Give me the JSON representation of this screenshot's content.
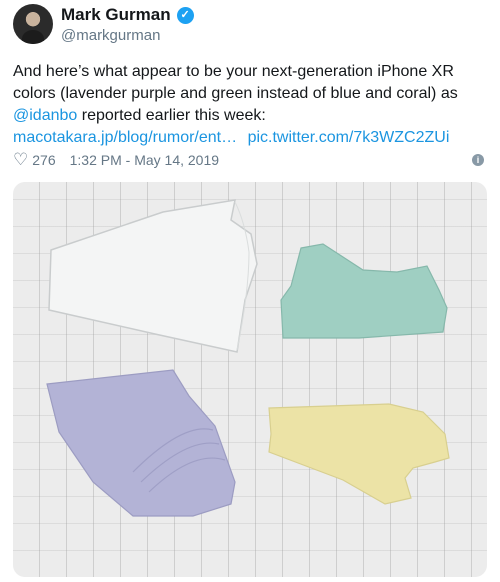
{
  "tweet": {
    "author_name": "Mark Gurman",
    "author_handle": "@markgurman",
    "text_part1": "And here’s what appear to be your next-generation iPhone XR colors (lavender purple and green instead of blue and coral) as ",
    "mention": "@idanbo",
    "text_part2": " reported earlier this week:",
    "link1": "macotakara.jp/blog/rumor/ent…",
    "link2": "pic.twitter.com/7k3WZC2ZUi",
    "likes": "276",
    "timestamp": "1:32 PM - May 14, 2019"
  },
  "icons": {
    "verified": "verified-badge-icon",
    "heart": "heart-icon",
    "info": "info-icon"
  },
  "colors": {
    "link": "#1b95e0",
    "verified": "#1da1f2",
    "lavender_piece": "#b3b3d6",
    "green_piece": "#9fcfc2",
    "yellow_piece": "#ece3a6",
    "clear_piece": "#f4f5f5"
  }
}
